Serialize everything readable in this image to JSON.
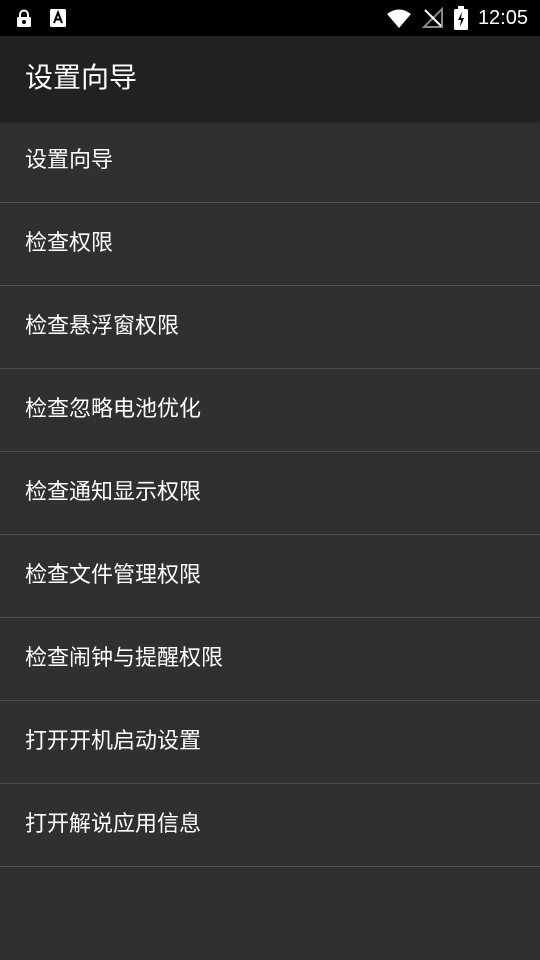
{
  "status_bar": {
    "time": "12:05",
    "left_icons": [
      "lock-notification-icon",
      "a-notification-icon"
    ],
    "right_icons": [
      "wifi-icon",
      "no-sim-icon",
      "battery-charging-icon"
    ]
  },
  "app_bar": {
    "title": "设置向导"
  },
  "menu": {
    "items": [
      {
        "label": "设置向导"
      },
      {
        "label": "检查权限"
      },
      {
        "label": "检查悬浮窗权限"
      },
      {
        "label": "检查忽略电池优化"
      },
      {
        "label": "检查通知显示权限"
      },
      {
        "label": "检查文件管理权限"
      },
      {
        "label": "检查闹钟与提醒权限"
      },
      {
        "label": "打开开机启动设置"
      },
      {
        "label": "打开解说应用信息"
      }
    ]
  },
  "colors": {
    "status_bar_bg": "#000000",
    "app_bar_bg": "#212121",
    "list_bg": "#303030",
    "divider": "#505050",
    "text": "#ffffff"
  }
}
